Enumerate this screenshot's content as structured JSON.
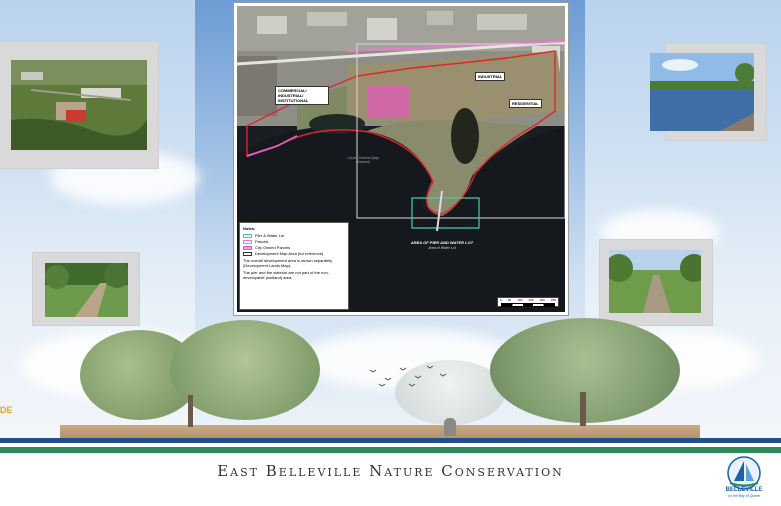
{
  "footer": {
    "title": "East Belleville Nature Conservation",
    "logo_caption": "BELLEVILLE",
    "logo_subcaption": "on the Bay of Quinte"
  },
  "edge_mark": "DE",
  "map": {
    "labels": {
      "commercial": "COMMERCIAL/ INDUSTRIAL/ INSTITUTIONAL",
      "industrial": "INDUSTRIAL",
      "residential": "RESIDENTIAL",
      "lake": "Loyal Crescent (bay Channel)",
      "area": "AREA OF PIER AND WATER LOT",
      "area_sub": "Area of Water Lot"
    },
    "legend": {
      "title": "Notes:",
      "items": [
        {
          "label": "Pier & Water Lot",
          "color": "#3fd1b0"
        },
        {
          "label": "Parcels",
          "color": "#e87ad0"
        },
        {
          "label": "City Owned Parcels",
          "color": "#e05bb8"
        },
        {
          "label": "Development Map Area (for reference)",
          "color": "#333333"
        }
      ],
      "note1": "The overall development area is shown separately (Development Lands Map).",
      "note2": "The pier and the waterlot are not part of the non-developable (wetland) area."
    },
    "scale_ticks": [
      "0",
      "50",
      "100",
      "150",
      "200",
      "250"
    ]
  },
  "colors": {
    "stripe_blue": "#1f4f8e",
    "stripe_green": "#2e8b57",
    "accent_teal": "#3fd1b0",
    "parcel_red": "#e0262b"
  }
}
